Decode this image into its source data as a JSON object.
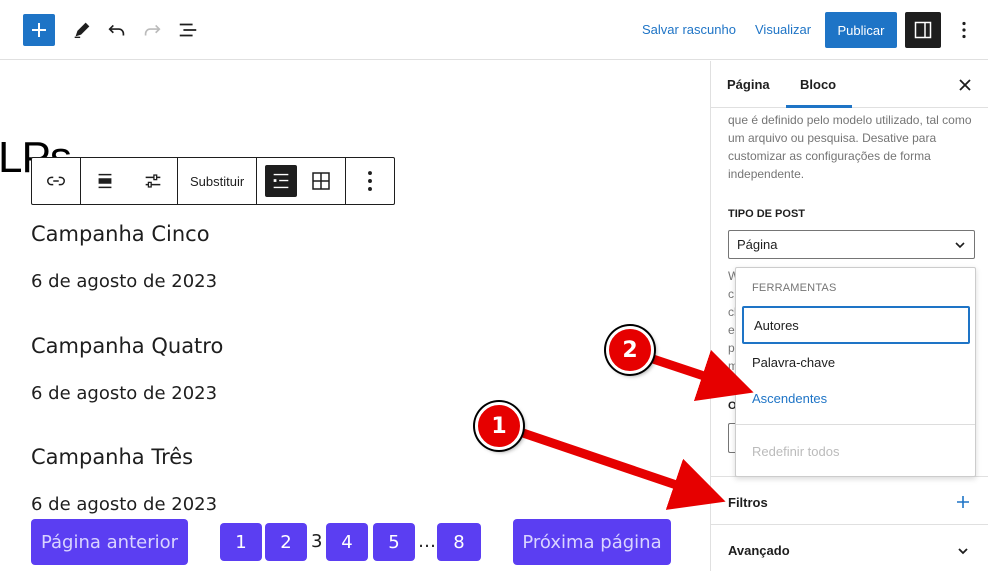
{
  "topbar": {
    "save_draft": "Salvar rascunho",
    "preview": "Visualizar",
    "publish": "Publicar"
  },
  "canvas": {
    "page_title": "LPs",
    "block_toolbar": {
      "replace": "Substituir"
    },
    "posts": [
      {
        "title": "Campanha Cinco",
        "date": "6 de agosto de 2023"
      },
      {
        "title": "Campanha Quatro",
        "date": "6 de agosto de 2023"
      },
      {
        "title": "Campanha Três",
        "date": "6 de agosto de 2023"
      }
    ],
    "pagination": {
      "prev": "Página anterior",
      "next": "Próxima página",
      "pages": [
        "1",
        "2",
        "3",
        "4",
        "5",
        "…",
        "8"
      ]
    }
  },
  "sidebar": {
    "tabs": [
      "Página",
      "Bloco"
    ],
    "description": "que é definido pelo modelo utilizado, tal como um arquivo ou pesquisa. Desative para customizar as configurações de forma independente.",
    "post_type_label": "Tipo de post",
    "post_type_value": "Página",
    "peek_letters": [
      "W",
      "c",
      "cl",
      "e",
      "p",
      "m"
    ],
    "peek_o": "O",
    "filters": "Filtros",
    "advanced": "Avançado"
  },
  "dropdown": {
    "heading": "Ferramentas",
    "items": [
      "Autores",
      "Palavra-chave",
      "Ascendentes"
    ],
    "reset": "Redefinir todos"
  },
  "annotations": [
    "1",
    "2"
  ],
  "colors": {
    "accent": "#1e74c6",
    "pager": "#5b3ef2",
    "annotation": "#e60000"
  }
}
